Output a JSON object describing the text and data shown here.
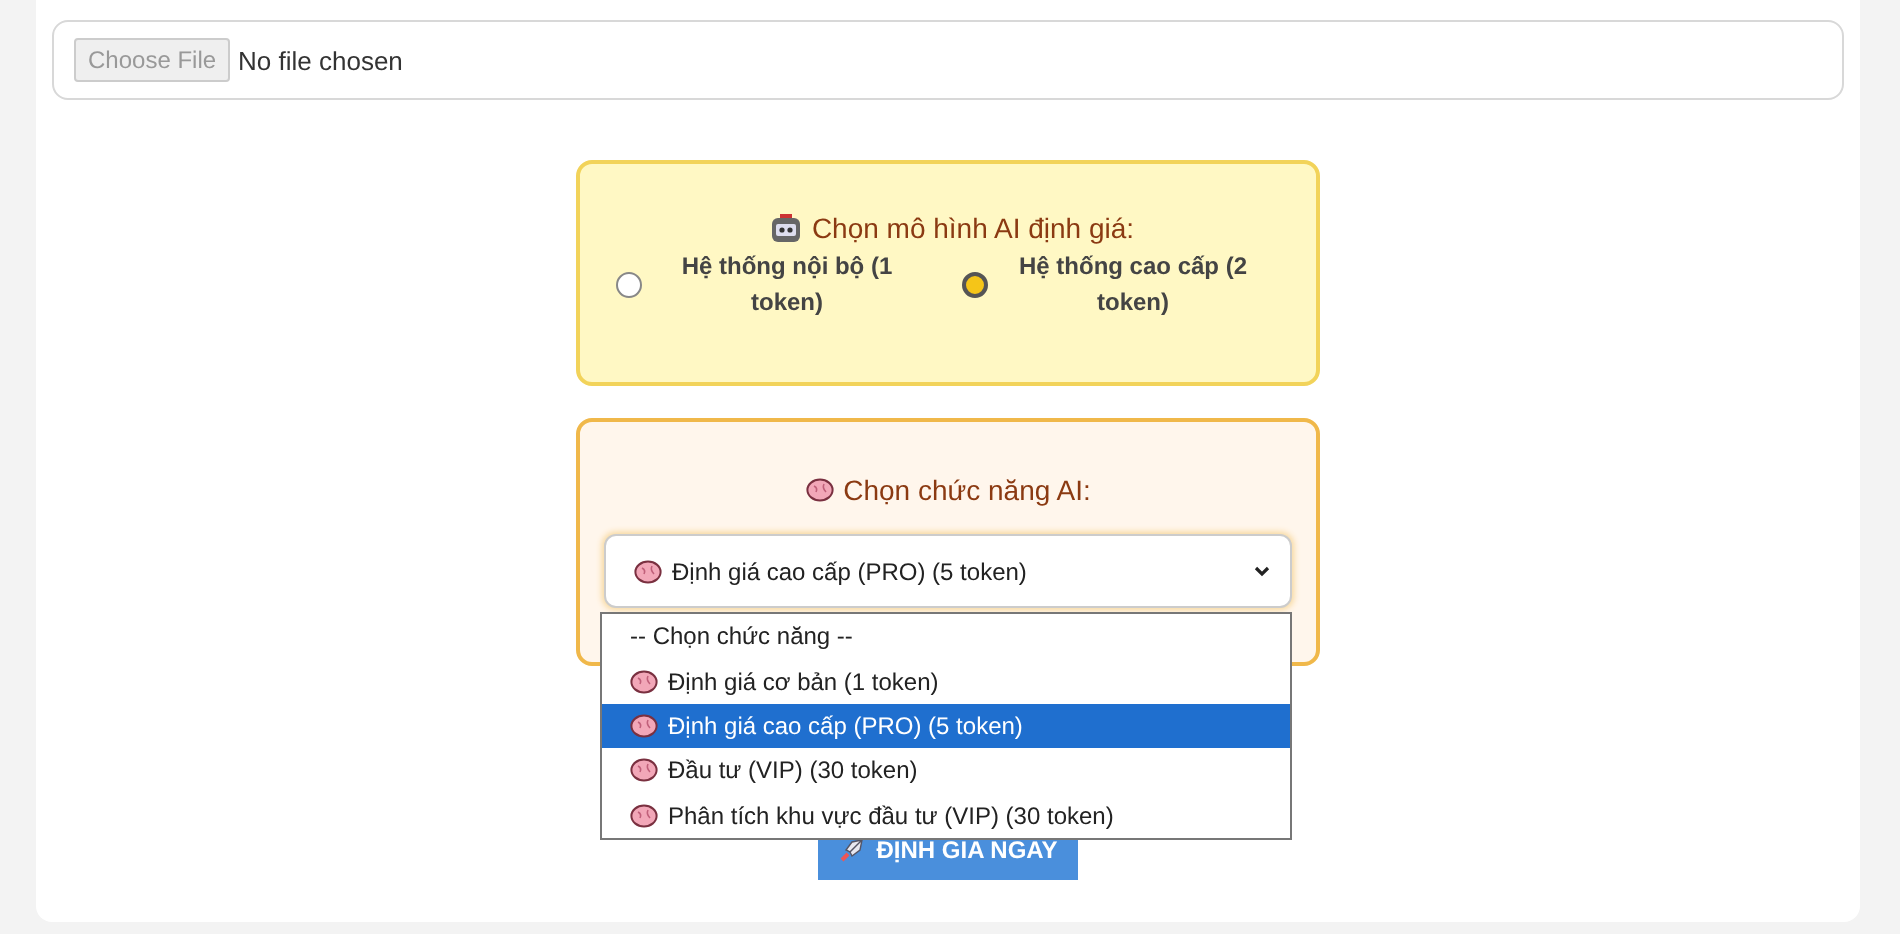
{
  "file_input": {
    "button": "Choose File",
    "status": "No file chosen"
  },
  "model_card": {
    "title": "Chọn mô hình AI định giá:",
    "options": [
      {
        "label": "Hệ thống nội bộ (1 token)",
        "selected": false
      },
      {
        "label": "Hệ thống cao cấp (2 token)",
        "selected": true
      }
    ]
  },
  "function_card": {
    "title": "Chọn chức năng AI:",
    "select_value": "Định giá cao cấp (PRO) (5 token)",
    "dropdown": [
      {
        "label": "-- Chọn chức năng --",
        "kind": "placeholder",
        "selected": false
      },
      {
        "label": "Định giá cơ bản (1 token)",
        "kind": "option",
        "selected": false
      },
      {
        "label": "Định giá cao cấp (PRO) (5 token)",
        "kind": "option",
        "selected": true
      },
      {
        "label": "Đầu tư (VIP) (30 token)",
        "kind": "option",
        "selected": false
      },
      {
        "label": "Phân tích khu vực đầu tư (VIP) (30 token)",
        "kind": "option",
        "selected": false
      }
    ]
  },
  "submit_button": "ĐỊNH GIA NGAY"
}
